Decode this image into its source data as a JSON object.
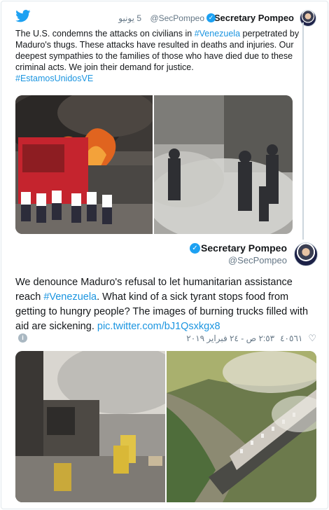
{
  "quoted": {
    "name": "Secretary Pompeo",
    "handle": "@SecPompeo",
    "time": "5 يونيو",
    "text_parts": {
      "p1": "The U.S. condemns the attacks on civilians in ",
      "hashtag1": "#Venezuela",
      "p2": " perpetrated by Maduro's thugs. These attacks have resulted in deaths and injuries. Our deepest sympathies to the families of those who have died due to these criminal acts. We join their demand for justice.",
      "hashtag2": "#EstamosUnidosVE"
    }
  },
  "main": {
    "name": "Secretary Pompeo",
    "handle": "@SecPompeo",
    "text_parts": {
      "p1": "We denounce Maduro's refusal to let humanitarian assistance reach ",
      "hashtag": "#Venezuela",
      "p2": ". What kind of a sick tyrant stops food from getting to hungry people? The images of burning trucks filled with aid are sickening. ",
      "link": "pic.twitter.com/bJ1Qsxkgx8"
    },
    "timestamp": "٢:٥٣ ص - ٢٤ فبراير ٢٠١٩",
    "likes": "٤٠٥٦١"
  },
  "colors": {
    "link": "#1b95e0",
    "verified": "#1da1f2",
    "muted": "#657786"
  }
}
